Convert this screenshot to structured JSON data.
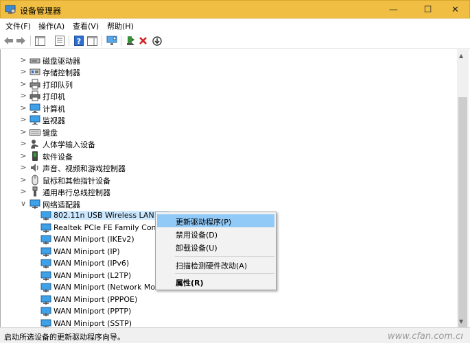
{
  "window": {
    "title": "设备管理器",
    "minimize": "—",
    "maximize": "☐",
    "close": "✕"
  },
  "menu": [
    "文件(F)",
    "操作(A)",
    "查看(V)",
    "帮助(H)"
  ],
  "tree": [
    {
      "label": "磁盘驱动器",
      "icon": "disk-drive-icon",
      "expander": ">"
    },
    {
      "label": "存储控制器",
      "icon": "storage-controller-icon",
      "expander": ">"
    },
    {
      "label": "打印队列",
      "icon": "print-queue-icon",
      "expander": ">"
    },
    {
      "label": "打印机",
      "icon": "printer-icon",
      "expander": ">"
    },
    {
      "label": "计算机",
      "icon": "computer-icon",
      "expander": ">"
    },
    {
      "label": "监视器",
      "icon": "monitor-icon",
      "expander": ">"
    },
    {
      "label": "键盘",
      "icon": "keyboard-icon",
      "expander": ">"
    },
    {
      "label": "人体学输入设备",
      "icon": "hid-icon",
      "expander": ">"
    },
    {
      "label": "软件设备",
      "icon": "software-device-icon",
      "expander": ">"
    },
    {
      "label": "声音、视频和游戏控制器",
      "icon": "sound-icon",
      "expander": ">"
    },
    {
      "label": "鼠标和其他指针设备",
      "icon": "mouse-icon",
      "expander": ">"
    },
    {
      "label": "通用串行总线控制器",
      "icon": "usb-icon",
      "expander": ">"
    },
    {
      "label": "网络适配器",
      "icon": "network-adapter-icon",
      "expander": "∨"
    }
  ],
  "adapters": [
    "802.11n USB Wireless LAN Ca",
    "Realtek PCIe FE Family Contro",
    "WAN Miniport (IKEv2)",
    "WAN Miniport (IP)",
    "WAN Miniport (IPv6)",
    "WAN Miniport (L2TP)",
    "WAN Miniport (Network Mon",
    "WAN Miniport (PPPOE)",
    "WAN Miniport (PPTP)",
    "WAN Miniport (SSTP)"
  ],
  "context_menu": {
    "update_driver": "更新驱动程序(P)",
    "disable": "禁用设备(D)",
    "uninstall": "卸载设备(U)",
    "scan": "扫描检测硬件改动(A)",
    "properties": "属性(R)"
  },
  "status": "启动所选设备的更新驱动程序向导。",
  "watermark": "www.cfan.com.cn",
  "colors": {
    "titlebar": "#f0be43",
    "selection": "#cce8ff",
    "menu_highlight": "#91c9f7"
  }
}
